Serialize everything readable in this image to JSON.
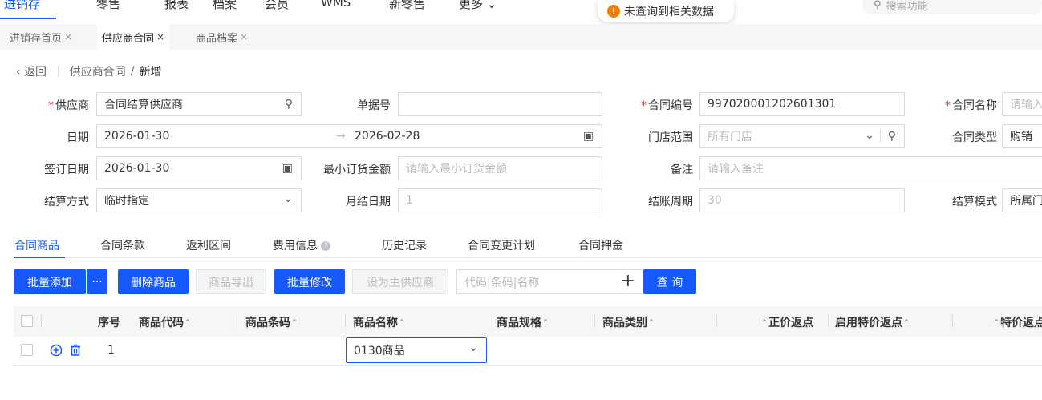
{
  "topnav": {
    "items": [
      "进销存",
      "零售",
      "报表",
      "档案",
      "会员",
      "WMS",
      "新零售",
      "更多"
    ],
    "more_arrow": "⌄"
  },
  "toast": {
    "icon": "!",
    "text": "未查询到相关数据"
  },
  "top_search": {
    "placeholder": "搜索功能"
  },
  "page_tabs": [
    {
      "label": "进销存首页",
      "close": "×"
    },
    {
      "label": "供应商合同",
      "close": "×"
    },
    {
      "label": "商品档案",
      "close": "×"
    }
  ],
  "breadcrumb": {
    "back": "返回",
    "parent": "供应商合同",
    "sep": "/",
    "current": "新增"
  },
  "form": {
    "supplier": {
      "label": "供应商",
      "value": "合同结算供应商"
    },
    "doc_no": {
      "label": "单据号",
      "value": ""
    },
    "contract_no": {
      "label": "合同编号",
      "value": "997020001202601301"
    },
    "contract_name": {
      "label": "合同名称",
      "placeholder": "请输入"
    },
    "date": {
      "label": "日期",
      "start": "2026-01-30",
      "arrow": "→",
      "end": "2026-02-28"
    },
    "store_scope": {
      "label": "门店范围",
      "placeholder": "所有门店"
    },
    "contract_type": {
      "label": "合同类型",
      "value": "购销"
    },
    "sign_date": {
      "label": "签订日期",
      "value": "2026-01-30"
    },
    "min_order": {
      "label": "最小订货金额",
      "placeholder": "请输入最小订货金额"
    },
    "remark": {
      "label": "备注",
      "placeholder": "请输入备注"
    },
    "settle_method": {
      "label": "结算方式",
      "value": "临时指定"
    },
    "monthly_date": {
      "label": "月结日期",
      "value": "1"
    },
    "settle_period": {
      "label": "结账周期",
      "value": "30"
    },
    "settle_mode": {
      "label": "结算模式",
      "value": "所属门"
    }
  },
  "content_tabs": [
    "合同商品",
    "合同条款",
    "返利区间",
    "费用信息",
    "历史记录",
    "合同变更计划",
    "合同押金"
  ],
  "toolbar": {
    "batch_add": "批量添加",
    "more": "···",
    "delete": "删除商品",
    "export": "商品导出",
    "batch_edit": "批量修改",
    "set_main": "设为主供应商",
    "search_placeholder": "代码|条码|名称",
    "plus": "+",
    "query": "查 询"
  },
  "table": {
    "columns": [
      "序号",
      "商品代码",
      "商品条码",
      "商品名称",
      "商品规格",
      "商品类别",
      "正价返点",
      "启用特价返点",
      "特价返点"
    ],
    "sort_glyph": "⌃",
    "rows": [
      {
        "index": "1",
        "code": "",
        "barcode": "",
        "name": "0130商品"
      }
    ]
  }
}
